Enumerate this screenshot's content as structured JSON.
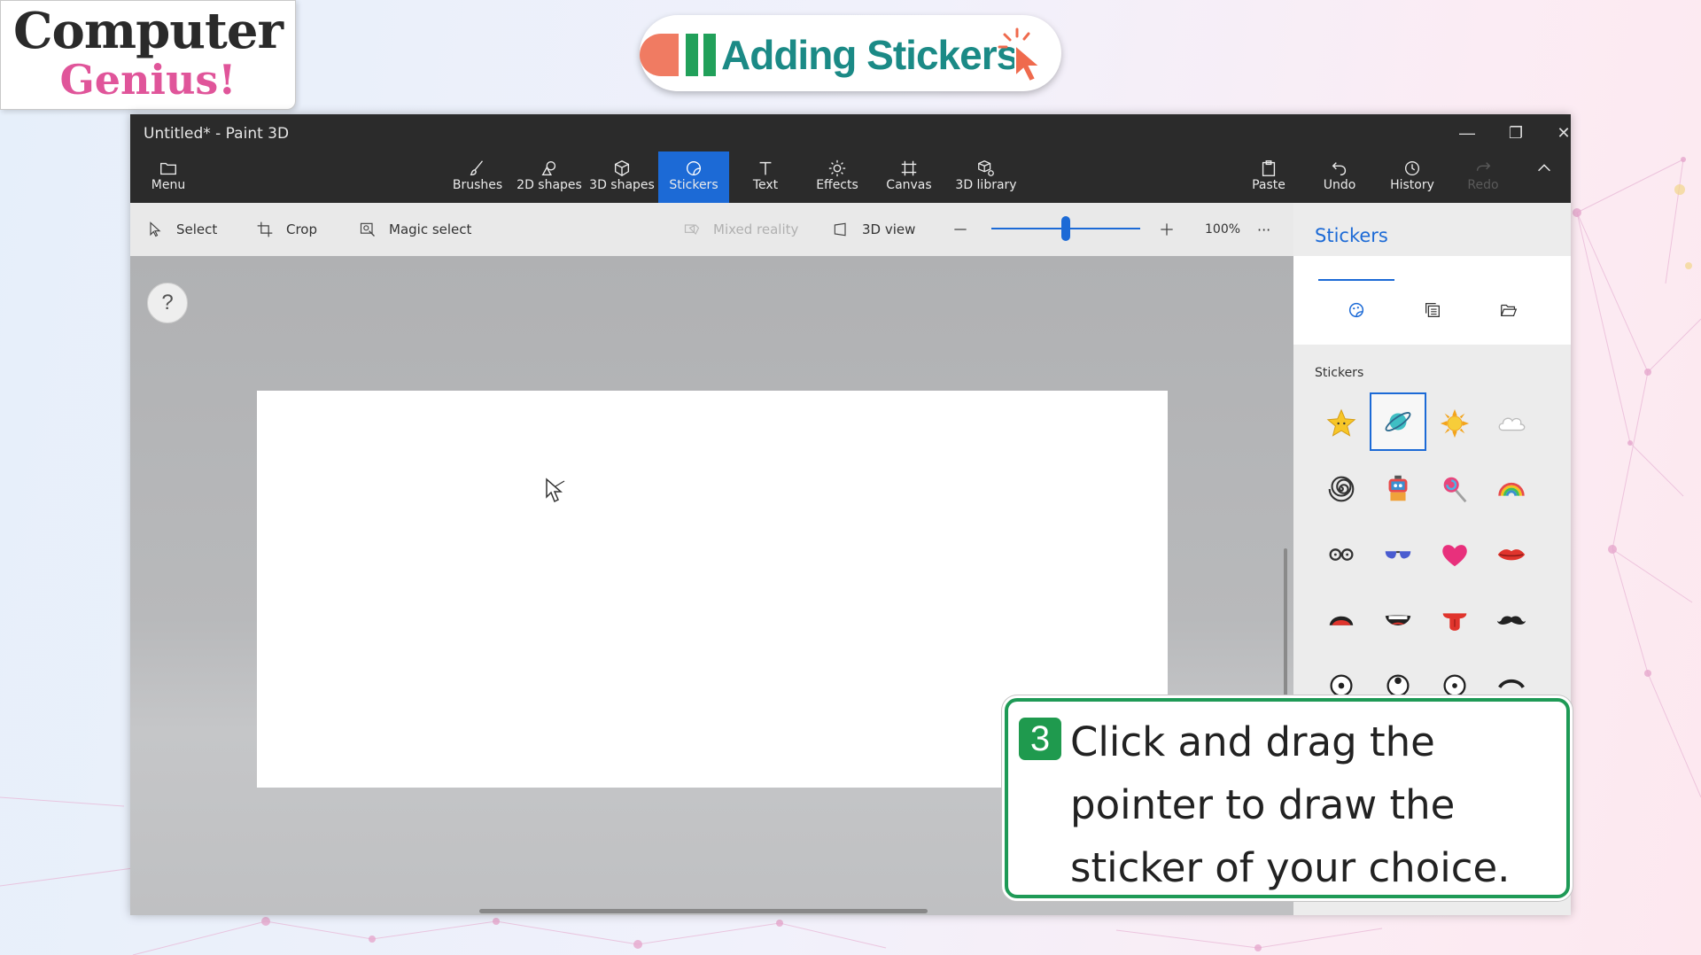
{
  "logo": {
    "line1": "Computer",
    "line2": "Genius!"
  },
  "lesson_title": "Adding Stickers",
  "window": {
    "title": "Untitled* - Paint 3D",
    "controls": [
      "minimize-icon",
      "restore-icon",
      "close-icon"
    ]
  },
  "ribbon": {
    "menu": "Menu",
    "tools": [
      "Brushes",
      "2D shapes",
      "3D shapes",
      "Stickers",
      "Text",
      "Effects",
      "Canvas",
      "3D library"
    ],
    "active_tool": "Stickers",
    "right": [
      "Paste",
      "Undo",
      "History",
      "Redo"
    ]
  },
  "toolbar": {
    "select": "Select",
    "crop": "Crop",
    "magic_select": "Magic select",
    "mixed_reality": "Mixed reality",
    "view_3d": "3D view",
    "zoom": "100%",
    "zoom_level": 0.5,
    "more": "···"
  },
  "help": "?",
  "panel": {
    "title": "Stickers",
    "tab_icons": [
      "sticker-palette-icon",
      "stamps-icon",
      "folder-open-icon"
    ],
    "section": "Stickers",
    "stickers": [
      "star",
      "planet",
      "sun",
      "cloud",
      "swirl",
      "robot",
      "lollipop",
      "rainbow",
      "glasses",
      "sunglasses",
      "heart",
      "lips",
      "mouth-open",
      "mouth-teeth",
      "tongue",
      "mustache",
      "eye",
      "eye",
      "eye",
      "eyebrow"
    ],
    "selected_sticker": "planet"
  },
  "callout": {
    "step": "3",
    "text": "Click and drag the pointer to draw the sticker of your choice."
  },
  "colors": {
    "accent": "#1c6ad6",
    "title_teal": "#1b8a86",
    "step_green": "#1f9a4e",
    "logo_pink": "#e0559a"
  }
}
